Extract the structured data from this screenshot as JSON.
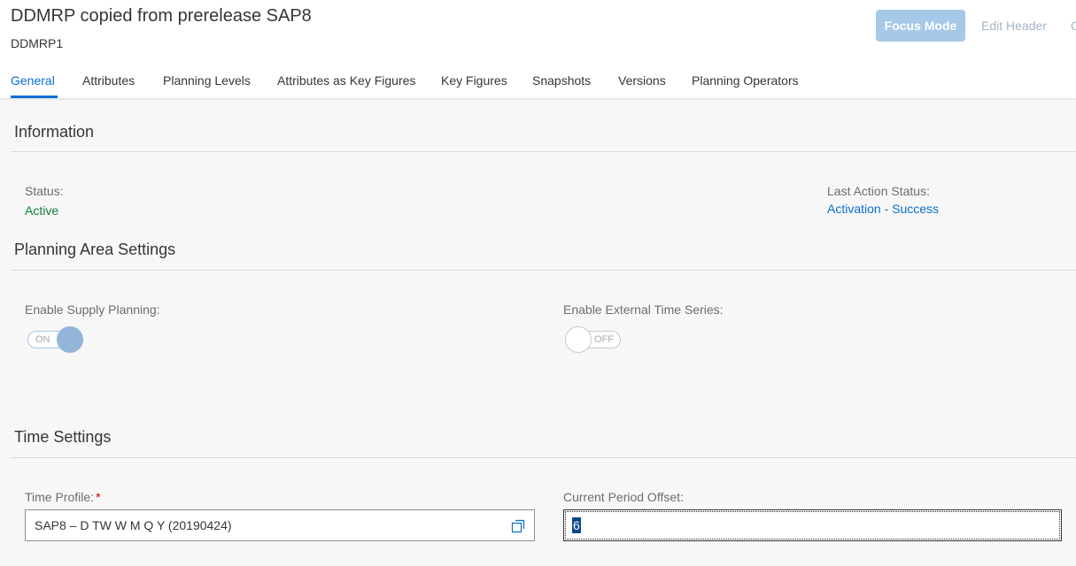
{
  "header": {
    "title": "DDMRP copied from prerelease SAP8",
    "subtitle": "DDMRP1",
    "focus_mode_label": "Focus Mode",
    "edit_header_label": "Edit Header",
    "clipped_label": "C"
  },
  "tabs": [
    {
      "label": "General",
      "active": true
    },
    {
      "label": "Attributes"
    },
    {
      "label": "Planning Levels"
    },
    {
      "label": "Attributes as Key Figures"
    },
    {
      "label": "Key Figures"
    },
    {
      "label": "Snapshots"
    },
    {
      "label": "Versions"
    },
    {
      "label": "Planning Operators"
    }
  ],
  "information": {
    "title": "Information",
    "status_label": "Status:",
    "status_value": "Active",
    "last_action_label": "Last Action Status:",
    "last_action_value": "Activation - Success"
  },
  "planning_area_settings": {
    "title": "Planning Area Settings",
    "supply_planning_label": "Enable Supply Planning:",
    "supply_planning_state": "ON",
    "external_ts_label": "Enable External Time Series:",
    "external_ts_state": "OFF"
  },
  "time_settings": {
    "title": "Time Settings",
    "time_profile_label": "Time Profile:",
    "time_profile_required": "*",
    "time_profile_value": "SAP8 – D TW W M Q Y (20190424)",
    "current_period_offset_label": "Current Period Offset:",
    "current_period_offset_value": "6"
  },
  "colors": {
    "accent": "#0a6ed1",
    "success": "#107e3e",
    "required": "#bb0000",
    "focus_button_bg": "#a6c8e9"
  },
  "icons": {
    "value_help": "value-help-icon"
  }
}
